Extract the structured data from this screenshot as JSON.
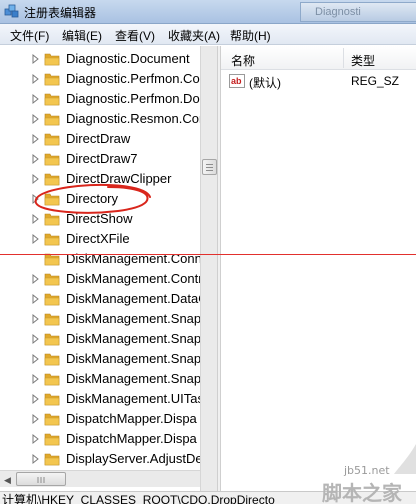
{
  "window": {
    "title": "注册表编辑器",
    "background_tab": "Diagnosti"
  },
  "menu": [
    {
      "label": "文件(F)"
    },
    {
      "label": "编辑(E)"
    },
    {
      "label": "查看(V)"
    },
    {
      "label": "收藏夹(A)"
    },
    {
      "label": "帮助(H)"
    }
  ],
  "tree": {
    "items": [
      {
        "label": "Diagnostic.Document",
        "expandable": true
      },
      {
        "label": "Diagnostic.Perfmon.Con",
        "expandable": true
      },
      {
        "label": "Diagnostic.Perfmon.Doc",
        "expandable": true
      },
      {
        "label": "Diagnostic.Resmon.Con",
        "expandable": true
      },
      {
        "label": "DirectDraw",
        "expandable": true
      },
      {
        "label": "DirectDraw7",
        "expandable": true
      },
      {
        "label": "DirectDrawClipper",
        "expandable": true
      },
      {
        "label": "Directory",
        "expandable": true
      },
      {
        "label": "DirectShow",
        "expandable": true
      },
      {
        "label": "DirectXFile",
        "expandable": true
      },
      {
        "label": "DiskManagement.Conn",
        "expandable": false
      },
      {
        "label": "DiskManagement.Contr",
        "expandable": true
      },
      {
        "label": "DiskManagement.DataO",
        "expandable": true
      },
      {
        "label": "DiskManagement.Snap",
        "expandable": true
      },
      {
        "label": "DiskManagement.Snap",
        "expandable": true
      },
      {
        "label": "DiskManagement.Snap",
        "expandable": true
      },
      {
        "label": "DiskManagement.Snap",
        "expandable": true
      },
      {
        "label": "DiskManagement.UITas",
        "expandable": true
      },
      {
        "label": "DispatchMapper.Dispa",
        "expandable": true
      },
      {
        "label": "DispatchMapper.Dispa",
        "expandable": true
      },
      {
        "label": "DisplayServer.AdjustDe",
        "expandable": true
      }
    ]
  },
  "list": {
    "columns": {
      "name": "名称",
      "type": "类型"
    },
    "rows": [
      {
        "icon": "ab",
        "name": "(默认)",
        "type": "REG_SZ"
      }
    ]
  },
  "status": {
    "path": "计算机\\HKEY_CLASSES_ROOT\\CDO.DropDirecto"
  },
  "watermark": {
    "site": "jb51.net",
    "text": "脚本之家"
  },
  "colors": {
    "annotation": "#e2302d",
    "folder": "#f3c64f"
  }
}
